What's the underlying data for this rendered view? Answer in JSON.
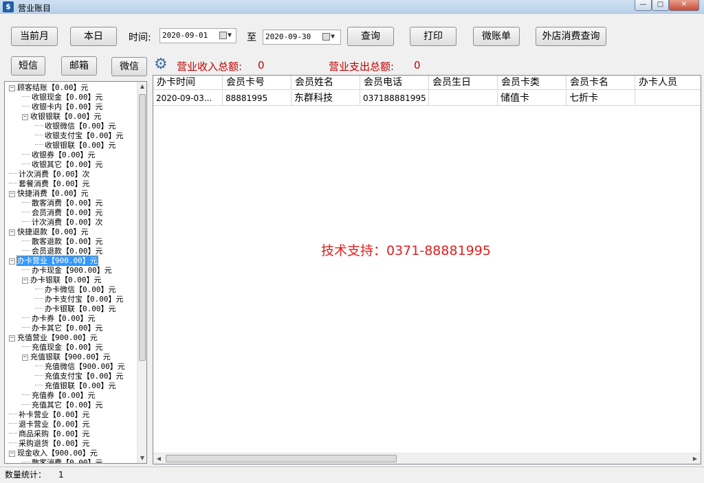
{
  "window": {
    "title": "营业账目",
    "min": "—",
    "max": "□",
    "close": "✕",
    "icon": "app-logo-icon"
  },
  "toolbar": {
    "current_month": "当前月",
    "this_day": "本日",
    "time_label": "时间:",
    "date_from": "2020-09-01",
    "to_label": "至",
    "date_to": "2020-09-30",
    "query": "查询",
    "print": "打印",
    "micro_bill": "微账单",
    "outside_query": "外店消费查询",
    "dropdown_glyph": "▼"
  },
  "side_buttons": {
    "sms": "短信",
    "mail": "邮箱",
    "wechat": "微信"
  },
  "summary": {
    "income_label": "营业收入总额:",
    "income_value": "0",
    "expense_label": "营业支出总额:",
    "expense_value": "0"
  },
  "tree": [
    {
      "level": 0,
      "toggle": "−",
      "text": "顾客结账【0.00】元"
    },
    {
      "level": 1,
      "text": "收银现金【0.00】元"
    },
    {
      "level": 1,
      "text": "收银卡内【0.00】元"
    },
    {
      "level": 1,
      "toggle": "−",
      "text": "收银银联【0.00】元"
    },
    {
      "level": 2,
      "text": "收银微信【0.00】元"
    },
    {
      "level": 2,
      "text": "收银支付宝【0.00】元"
    },
    {
      "level": 2,
      "text": "收银银联【0.00】元"
    },
    {
      "level": 1,
      "text": "收银券【0.00】元"
    },
    {
      "level": 1,
      "text": "收银其它【0.00】元"
    },
    {
      "level": 0,
      "text": "计次消费【0.00】次"
    },
    {
      "level": 0,
      "text": "套餐消费【0.00】元"
    },
    {
      "level": 0,
      "toggle": "−",
      "text": "快捷消费【0.00】元"
    },
    {
      "level": 1,
      "text": "散客消费【0.00】元"
    },
    {
      "level": 1,
      "text": "会员消费【0.00】元"
    },
    {
      "level": 1,
      "text": "计次消费【0.00】次"
    },
    {
      "level": 0,
      "toggle": "−",
      "text": "快捷退款【0.00】元"
    },
    {
      "level": 1,
      "text": "散客退款【0.00】元"
    },
    {
      "level": 1,
      "text": "会员退款【0.00】元"
    },
    {
      "level": 0,
      "toggle": "−",
      "text": "办卡营业【900.00】元",
      "selected": true
    },
    {
      "level": 1,
      "text": "办卡现金【900.00】元"
    },
    {
      "level": 1,
      "toggle": "−",
      "text": "办卡银联【0.00】元"
    },
    {
      "level": 2,
      "text": "办卡微信【0.00】元"
    },
    {
      "level": 2,
      "text": "办卡支付宝【0.00】元"
    },
    {
      "level": 2,
      "text": "办卡银联【0.00】元"
    },
    {
      "level": 1,
      "text": "办卡券【0.00】元"
    },
    {
      "level": 1,
      "text": "办卡其它【0.00】元"
    },
    {
      "level": 0,
      "toggle": "−",
      "text": "充值营业【900.00】元"
    },
    {
      "level": 1,
      "text": "充值现金【0.00】元"
    },
    {
      "level": 1,
      "toggle": "−",
      "text": "充值银联【900.00】元"
    },
    {
      "level": 2,
      "text": "充值微信【900.00】元"
    },
    {
      "level": 2,
      "text": "充值支付宝【0.00】元"
    },
    {
      "level": 2,
      "text": "充值银联【0.00】元"
    },
    {
      "level": 1,
      "text": "充值券【0.00】元"
    },
    {
      "level": 1,
      "text": "充值其它【0.00】元"
    },
    {
      "level": 0,
      "text": "补卡营业【0.00】元"
    },
    {
      "level": 0,
      "text": "退卡营业【0.00】元"
    },
    {
      "level": 0,
      "text": "商品采购【0.00】元"
    },
    {
      "level": 0,
      "text": "采购退货【0.00】元"
    },
    {
      "level": 0,
      "toggle": "−",
      "text": "现金收入【900.00】元"
    },
    {
      "level": 1,
      "text": "散客消费【0.00】元"
    }
  ],
  "grid": {
    "columns": [
      "办卡时间",
      "会员卡号",
      "会员姓名",
      "会员电话",
      "会员生日",
      "会员卡类",
      "会员卡名",
      "办卡人员"
    ],
    "rows": [
      [
        "2020-09-03...",
        "88881995",
        "东群科技",
        "037188881995",
        "",
        "储值卡",
        "七折卡",
        ""
      ]
    ]
  },
  "support_text": "技术支持：0371-88881995",
  "status": {
    "count_label": "数量统计：",
    "count_value": "1"
  }
}
